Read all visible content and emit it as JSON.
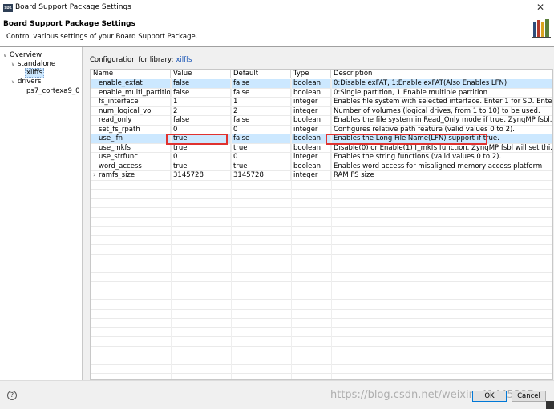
{
  "window": {
    "icon_label": "SDK",
    "title": "Board Support Package Settings",
    "close_glyph": "✕"
  },
  "header": {
    "title": "Board Support Package Settings",
    "description": "Control various settings of your Board Support Package."
  },
  "tree": {
    "items": [
      {
        "label": "Overview",
        "expanded": true
      },
      {
        "label": "standalone",
        "expanded": true
      },
      {
        "label": "xilffs",
        "selected": true
      },
      {
        "label": "drivers",
        "expanded": true
      },
      {
        "label": "ps7_cortexa9_0"
      }
    ]
  },
  "config": {
    "prefix": "Configuration for library:",
    "library": "xilffs"
  },
  "table": {
    "columns": [
      "Name",
      "Value",
      "Default",
      "Type",
      "Description"
    ],
    "rows": [
      {
        "name": "enable_exfat",
        "value": "false",
        "default": "false",
        "type": "boolean",
        "description": "0:Disable exFAT, 1:Enable exFAT(Also Enables LFN)"
      },
      {
        "name": "enable_multi_partition",
        "value": "false",
        "default": "false",
        "type": "boolean",
        "description": "0:Single partition, 1:Enable multiple partition"
      },
      {
        "name": "fs_interface",
        "value": "1",
        "default": "1",
        "type": "integer",
        "description": "Enables file system with selected interface. Enter 1 for SD. Ente..."
      },
      {
        "name": "num_logical_vol",
        "value": "2",
        "default": "2",
        "type": "integer",
        "description": "Number of volumes (logical drives, from 1 to 10) to be used."
      },
      {
        "name": "read_only",
        "value": "false",
        "default": "false",
        "type": "boolean",
        "description": "Enables the file system in Read_Only mode if true. ZynqMP fsbl..."
      },
      {
        "name": "set_fs_rpath",
        "value": "0",
        "default": "0",
        "type": "integer",
        "description": "Configures relative path feature (valid values 0 to 2)."
      },
      {
        "name": "use_lfn",
        "value": "true",
        "default": "false",
        "type": "boolean",
        "description": "Enables the Long File Name(LFN) support if true."
      },
      {
        "name": "use_mkfs",
        "value": "true",
        "default": "true",
        "type": "boolean",
        "description": "Disable(0) or Enable(1) f_mkfs function. ZynqMP fsbl will set thi..."
      },
      {
        "name": "use_strfunc",
        "value": "0",
        "default": "0",
        "type": "integer",
        "description": "Enables the string functions (valid values 0 to 2)."
      },
      {
        "name": "word_access",
        "value": "true",
        "default": "true",
        "type": "boolean",
        "description": "Enables word access for misaligned memory access platform"
      },
      {
        "name": "ramfs_size",
        "value": "3145728",
        "default": "3145728",
        "type": "integer",
        "description": "RAM FS size",
        "expandable": true
      }
    ]
  },
  "footer": {
    "help_glyph": "?",
    "ok_label": "OK",
    "cancel_label": "Cancel",
    "watermark": "https://blog.csdn.net/weixin_41445387"
  },
  "colors": {
    "selected_row": "#cce8ff",
    "highlight_box": "#e0322f",
    "link": "#1a55b5"
  }
}
